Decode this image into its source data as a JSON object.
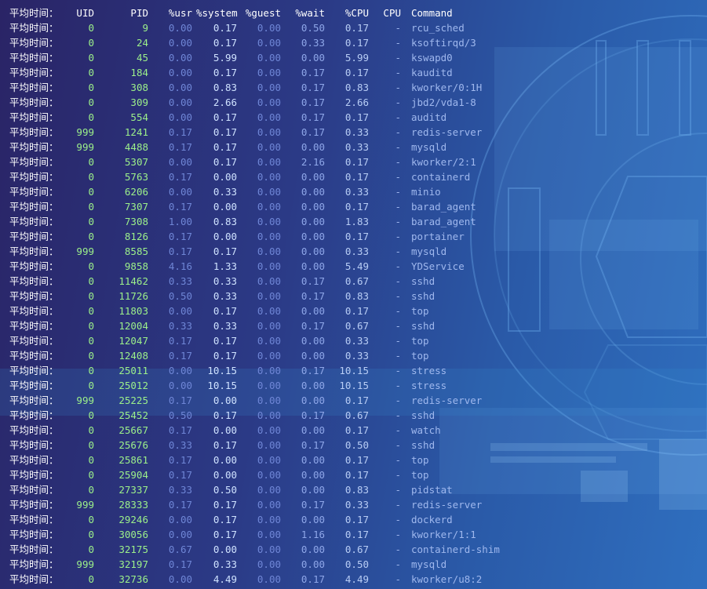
{
  "header": {
    "label": "平均时间：",
    "uid": "UID",
    "pid": "PID",
    "usr": "%usr",
    "system": "%system",
    "guest": "%guest",
    "wait": "%wait",
    "cpu": "%CPU",
    "core": "CPU",
    "command": "Command"
  },
  "rows": [
    {
      "label": "平均时间：",
      "uid": "0",
      "pid": "9",
      "usr": "0.00",
      "system": "0.17",
      "guest": "0.00",
      "wait": "0.50",
      "cpu": "0.17",
      "core": "-",
      "command": "rcu_sched"
    },
    {
      "label": "平均时间：",
      "uid": "0",
      "pid": "24",
      "usr": "0.00",
      "system": "0.17",
      "guest": "0.00",
      "wait": "0.33",
      "cpu": "0.17",
      "core": "-",
      "command": "ksoftirqd/3"
    },
    {
      "label": "平均时间：",
      "uid": "0",
      "pid": "45",
      "usr": "0.00",
      "system": "5.99",
      "guest": "0.00",
      "wait": "0.00",
      "cpu": "5.99",
      "core": "-",
      "command": "kswapd0"
    },
    {
      "label": "平均时间：",
      "uid": "0",
      "pid": "184",
      "usr": "0.00",
      "system": "0.17",
      "guest": "0.00",
      "wait": "0.17",
      "cpu": "0.17",
      "core": "-",
      "command": "kauditd"
    },
    {
      "label": "平均时间：",
      "uid": "0",
      "pid": "308",
      "usr": "0.00",
      "system": "0.83",
      "guest": "0.00",
      "wait": "0.17",
      "cpu": "0.83",
      "core": "-",
      "command": "kworker/0:1H"
    },
    {
      "label": "平均时间：",
      "uid": "0",
      "pid": "309",
      "usr": "0.00",
      "system": "2.66",
      "guest": "0.00",
      "wait": "0.17",
      "cpu": "2.66",
      "core": "-",
      "command": "jbd2/vda1-8"
    },
    {
      "label": "平均时间：",
      "uid": "0",
      "pid": "554",
      "usr": "0.00",
      "system": "0.17",
      "guest": "0.00",
      "wait": "0.17",
      "cpu": "0.17",
      "core": "-",
      "command": "auditd"
    },
    {
      "label": "平均时间：",
      "uid": "999",
      "pid": "1241",
      "usr": "0.17",
      "system": "0.17",
      "guest": "0.00",
      "wait": "0.17",
      "cpu": "0.33",
      "core": "-",
      "command": "redis-server"
    },
    {
      "label": "平均时间：",
      "uid": "999",
      "pid": "4488",
      "usr": "0.17",
      "system": "0.17",
      "guest": "0.00",
      "wait": "0.00",
      "cpu": "0.33",
      "core": "-",
      "command": "mysqld"
    },
    {
      "label": "平均时间：",
      "uid": "0",
      "pid": "5307",
      "usr": "0.00",
      "system": "0.17",
      "guest": "0.00",
      "wait": "2.16",
      "cpu": "0.17",
      "core": "-",
      "command": "kworker/2:1"
    },
    {
      "label": "平均时间：",
      "uid": "0",
      "pid": "5763",
      "usr": "0.17",
      "system": "0.00",
      "guest": "0.00",
      "wait": "0.00",
      "cpu": "0.17",
      "core": "-",
      "command": "containerd"
    },
    {
      "label": "平均时间：",
      "uid": "0",
      "pid": "6206",
      "usr": "0.00",
      "system": "0.33",
      "guest": "0.00",
      "wait": "0.00",
      "cpu": "0.33",
      "core": "-",
      "command": "minio"
    },
    {
      "label": "平均时间：",
      "uid": "0",
      "pid": "7307",
      "usr": "0.17",
      "system": "0.00",
      "guest": "0.00",
      "wait": "0.00",
      "cpu": "0.17",
      "core": "-",
      "command": "barad_agent"
    },
    {
      "label": "平均时间：",
      "uid": "0",
      "pid": "7308",
      "usr": "1.00",
      "system": "0.83",
      "guest": "0.00",
      "wait": "0.00",
      "cpu": "1.83",
      "core": "-",
      "command": "barad_agent"
    },
    {
      "label": "平均时间：",
      "uid": "0",
      "pid": "8126",
      "usr": "0.17",
      "system": "0.00",
      "guest": "0.00",
      "wait": "0.00",
      "cpu": "0.17",
      "core": "-",
      "command": "portainer"
    },
    {
      "label": "平均时间：",
      "uid": "999",
      "pid": "8585",
      "usr": "0.17",
      "system": "0.17",
      "guest": "0.00",
      "wait": "0.00",
      "cpu": "0.33",
      "core": "-",
      "command": "mysqld"
    },
    {
      "label": "平均时间：",
      "uid": "0",
      "pid": "9858",
      "usr": "4.16",
      "system": "1.33",
      "guest": "0.00",
      "wait": "0.00",
      "cpu": "5.49",
      "core": "-",
      "command": "YDService"
    },
    {
      "label": "平均时间：",
      "uid": "0",
      "pid": "11462",
      "usr": "0.33",
      "system": "0.33",
      "guest": "0.00",
      "wait": "0.17",
      "cpu": "0.67",
      "core": "-",
      "command": "sshd"
    },
    {
      "label": "平均时间：",
      "uid": "0",
      "pid": "11726",
      "usr": "0.50",
      "system": "0.33",
      "guest": "0.00",
      "wait": "0.17",
      "cpu": "0.83",
      "core": "-",
      "command": "sshd"
    },
    {
      "label": "平均时间：",
      "uid": "0",
      "pid": "11803",
      "usr": "0.00",
      "system": "0.17",
      "guest": "0.00",
      "wait": "0.00",
      "cpu": "0.17",
      "core": "-",
      "command": "top"
    },
    {
      "label": "平均时间：",
      "uid": "0",
      "pid": "12004",
      "usr": "0.33",
      "system": "0.33",
      "guest": "0.00",
      "wait": "0.17",
      "cpu": "0.67",
      "core": "-",
      "command": "sshd"
    },
    {
      "label": "平均时间：",
      "uid": "0",
      "pid": "12047",
      "usr": "0.17",
      "system": "0.17",
      "guest": "0.00",
      "wait": "0.00",
      "cpu": "0.33",
      "core": "-",
      "command": "top"
    },
    {
      "label": "平均时间：",
      "uid": "0",
      "pid": "12408",
      "usr": "0.17",
      "system": "0.17",
      "guest": "0.00",
      "wait": "0.00",
      "cpu": "0.33",
      "core": "-",
      "command": "top"
    },
    {
      "label": "平均时间：",
      "uid": "0",
      "pid": "25011",
      "usr": "0.00",
      "system": "10.15",
      "guest": "0.00",
      "wait": "0.17",
      "cpu": "10.15",
      "core": "-",
      "command": "stress"
    },
    {
      "label": "平均时间：",
      "uid": "0",
      "pid": "25012",
      "usr": "0.00",
      "system": "10.15",
      "guest": "0.00",
      "wait": "0.00",
      "cpu": "10.15",
      "core": "-",
      "command": "stress"
    },
    {
      "label": "平均时间：",
      "uid": "999",
      "pid": "25225",
      "usr": "0.17",
      "system": "0.00",
      "guest": "0.00",
      "wait": "0.00",
      "cpu": "0.17",
      "core": "-",
      "command": "redis-server"
    },
    {
      "label": "平均时间：",
      "uid": "0",
      "pid": "25452",
      "usr": "0.50",
      "system": "0.17",
      "guest": "0.00",
      "wait": "0.17",
      "cpu": "0.67",
      "core": "-",
      "command": "sshd"
    },
    {
      "label": "平均时间：",
      "uid": "0",
      "pid": "25667",
      "usr": "0.17",
      "system": "0.00",
      "guest": "0.00",
      "wait": "0.00",
      "cpu": "0.17",
      "core": "-",
      "command": "watch"
    },
    {
      "label": "平均时间：",
      "uid": "0",
      "pid": "25676",
      "usr": "0.33",
      "system": "0.17",
      "guest": "0.00",
      "wait": "0.17",
      "cpu": "0.50",
      "core": "-",
      "command": "sshd"
    },
    {
      "label": "平均时间：",
      "uid": "0",
      "pid": "25861",
      "usr": "0.17",
      "system": "0.00",
      "guest": "0.00",
      "wait": "0.00",
      "cpu": "0.17",
      "core": "-",
      "command": "top"
    },
    {
      "label": "平均时间：",
      "uid": "0",
      "pid": "25904",
      "usr": "0.17",
      "system": "0.00",
      "guest": "0.00",
      "wait": "0.00",
      "cpu": "0.17",
      "core": "-",
      "command": "top"
    },
    {
      "label": "平均时间：",
      "uid": "0",
      "pid": "27337",
      "usr": "0.33",
      "system": "0.50",
      "guest": "0.00",
      "wait": "0.00",
      "cpu": "0.83",
      "core": "-",
      "command": "pidstat"
    },
    {
      "label": "平均时间：",
      "uid": "999",
      "pid": "28333",
      "usr": "0.17",
      "system": "0.17",
      "guest": "0.00",
      "wait": "0.17",
      "cpu": "0.33",
      "core": "-",
      "command": "redis-server"
    },
    {
      "label": "平均时间：",
      "uid": "0",
      "pid": "29246",
      "usr": "0.00",
      "system": "0.17",
      "guest": "0.00",
      "wait": "0.00",
      "cpu": "0.17",
      "core": "-",
      "command": "dockerd"
    },
    {
      "label": "平均时间：",
      "uid": "0",
      "pid": "30056",
      "usr": "0.00",
      "system": "0.17",
      "guest": "0.00",
      "wait": "1.16",
      "cpu": "0.17",
      "core": "-",
      "command": "kworker/1:1"
    },
    {
      "label": "平均时间：",
      "uid": "0",
      "pid": "32175",
      "usr": "0.67",
      "system": "0.00",
      "guest": "0.00",
      "wait": "0.00",
      "cpu": "0.67",
      "core": "-",
      "command": "containerd-shim"
    },
    {
      "label": "平均时间：",
      "uid": "999",
      "pid": "32197",
      "usr": "0.17",
      "system": "0.33",
      "guest": "0.00",
      "wait": "0.00",
      "cpu": "0.50",
      "core": "-",
      "command": "mysqld"
    },
    {
      "label": "平均时间：",
      "uid": "0",
      "pid": "32736",
      "usr": "0.00",
      "system": "4.49",
      "guest": "0.00",
      "wait": "0.17",
      "cpu": "4.49",
      "core": "-",
      "command": "kworker/u8:2"
    }
  ]
}
